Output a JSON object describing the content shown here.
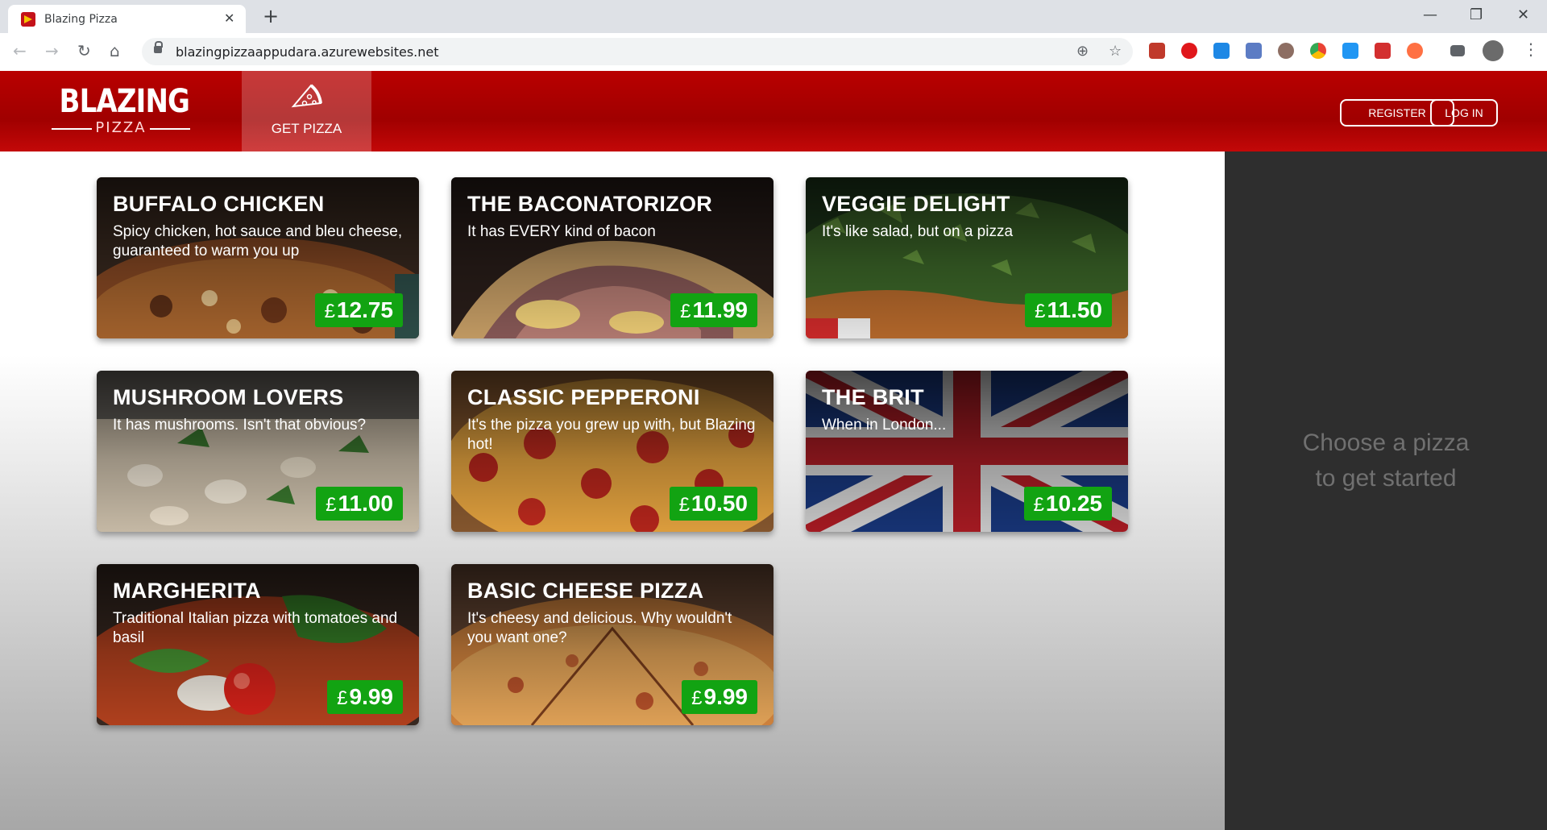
{
  "browser": {
    "tab_title": "Blazing Pizza",
    "tab_close": "✕",
    "new_tab": "+",
    "url": "blazingpizzaappudara.azurewebsites.net",
    "window_controls": [
      "—",
      "❐",
      "✕"
    ],
    "nav_icons": [
      "back-icon",
      "forward-icon",
      "reload-icon",
      "home-icon"
    ],
    "extension_icons": [
      "add-icon",
      "star-icon",
      "ext-red-icon",
      "opera-icon",
      "check-icon",
      "camera-icon",
      "cookie-icon",
      "chrome-icon",
      "download-icon",
      "badge-icon",
      "ext-dots-icon",
      "playlist-icon",
      "avatar",
      "menu-icon"
    ]
  },
  "header": {
    "logo_main": "BLAZING",
    "logo_sub": "PIZZA",
    "nav_get_pizza": "GET PIZZA",
    "register": "REGISTER",
    "login": "LOG IN",
    "accent": "#b90000"
  },
  "pizzas": [
    {
      "name": "BUFFALO CHICKEN",
      "description": "Spicy chicken, hot sauce and bleu cheese, guaranteed to warm you up",
      "currency": "£",
      "price": "12.75"
    },
    {
      "name": "THE BACONATORIZOR",
      "description": "It has EVERY kind of bacon",
      "currency": "£",
      "price": "11.99"
    },
    {
      "name": "VEGGIE DELIGHT",
      "description": "It's like salad, but on a pizza",
      "currency": "£",
      "price": "11.50"
    },
    {
      "name": "MUSHROOM LOVERS",
      "description": "It has mushrooms. Isn't that obvious?",
      "currency": "£",
      "price": "11.00"
    },
    {
      "name": "CLASSIC PEPPERONI",
      "description": "It's the pizza you grew up with, but Blazing hot!",
      "currency": "£",
      "price": "10.50"
    },
    {
      "name": "THE BRIT",
      "description": "When in London...",
      "currency": "£",
      "price": "10.25"
    },
    {
      "name": "MARGHERITA",
      "description": "Traditional Italian pizza with tomatoes and basil",
      "currency": "£",
      "price": "9.99"
    },
    {
      "name": "BASIC CHEESE PIZZA",
      "description": "It's cheesy and delicious. Why wouldn't you want one?",
      "currency": "£",
      "price": "9.99"
    }
  ],
  "sidebar": {
    "line1": "Choose a pizza",
    "line2": "to get started"
  },
  "colors": {
    "price_badge": "#12a312",
    "sidebar_bg": "#2e2e2e"
  }
}
